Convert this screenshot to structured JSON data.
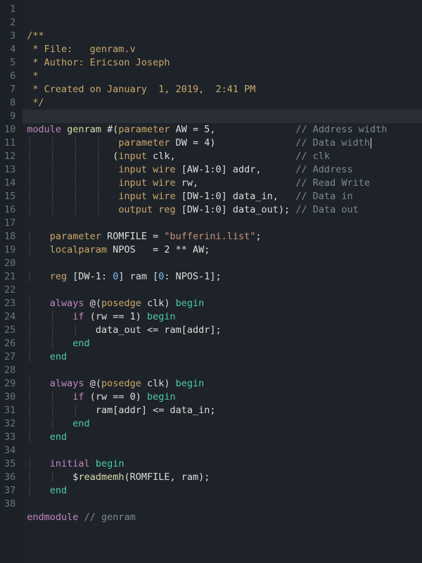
{
  "editor": {
    "filename": "genram.v",
    "author": "Ericson Joseph",
    "created": "January  1, 2019,  2:41 PM",
    "highlighted_line": 9,
    "line_count": 38,
    "lines": {
      "l1": "/**",
      "l2": " * File:   genram.v",
      "l3": " * Author: Ericson Joseph",
      "l4": " *",
      "l5": " * Created on January  1, 2019,  2:41 PM",
      "l6": " */",
      "l7": "",
      "l8": "module genram #(parameter AW = 5,              // Address width",
      "l9": "                parameter DW = 4)              // Data width",
      "l10": "               (input clk,                     // clk",
      "l11": "                input wire [AW-1:0] addr,      // Address",
      "l12": "                input wire rw,                 // Read Write",
      "l13": "                input wire [DW-1:0] data_in,   // Data in",
      "l14": "                output reg [DW-1:0] data_out); // Data out",
      "l15": "",
      "l16": "    parameter ROMFILE = \"bufferini.list\";",
      "l17": "    localparam NPOS   = 2 ** AW;",
      "l18": "",
      "l19": "    reg [DW-1: 0] ram [0: NPOS-1];",
      "l20": "",
      "l21": "    always @(posedge clk) begin",
      "l22": "        if (rw == 1) begin",
      "l23": "            data_out <= ram[addr];",
      "l24": "        end",
      "l25": "    end",
      "l26": "",
      "l27": "    always @(posedge clk) begin",
      "l28": "        if (rw == 0) begin",
      "l29": "            ram[addr] <= data_in;",
      "l30": "        end",
      "l31": "    end",
      "l32": "",
      "l33": "    initial begin",
      "l34": "        $readmemh(ROMFILE, ram);",
      "l35": "    end",
      "l36": "",
      "l37": "endmodule // genram",
      "l38": ""
    }
  }
}
